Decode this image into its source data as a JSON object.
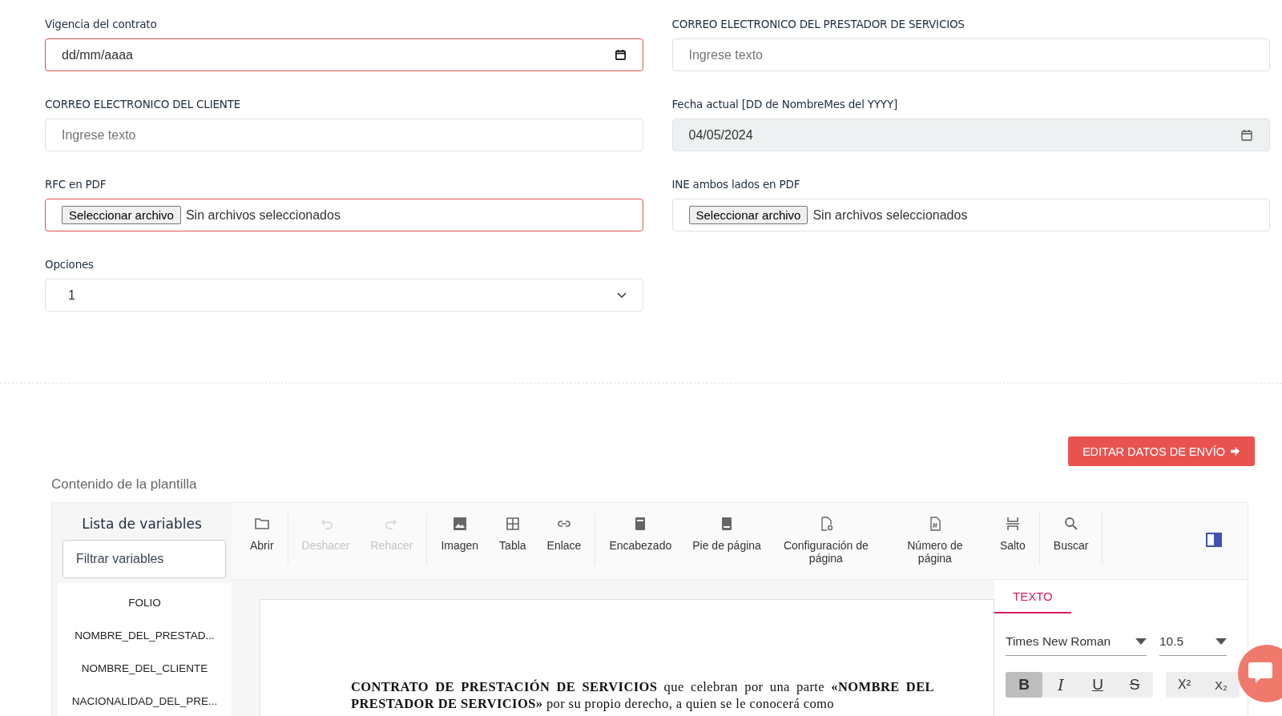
{
  "form_fields": [
    {
      "label": "Vigencia del contrato",
      "kind": "date",
      "value": "dd/mm/aaaa",
      "invalid": true,
      "disabled": false
    },
    {
      "label": "CORREO ELECTRONICO DEL PRESTADOR DE SERVICIOS",
      "kind": "text",
      "placeholder": "Ingrese texto",
      "invalid": false,
      "disabled": false
    },
    {
      "label": "CORREO ELECTRONICO DEL CLIENTE",
      "kind": "text",
      "placeholder": "Ingrese texto",
      "invalid": false,
      "disabled": false
    },
    {
      "label": "Fecha actual [DD de NombreMes del YYYY]",
      "kind": "date",
      "value": "04/05/2024",
      "invalid": false,
      "disabled": true
    },
    {
      "label": "RFC en PDF",
      "kind": "file",
      "button": "Seleccionar archivo",
      "value": "Sin archivos seleccionados",
      "invalid": true,
      "disabled": false
    },
    {
      "label": "INE ambos lados en PDF",
      "kind": "file",
      "button": "Seleccionar archivo",
      "value": "Sin archivos seleccionados",
      "invalid": false,
      "disabled": false
    },
    {
      "label": "Opciones",
      "kind": "select",
      "value": "1",
      "invalid": false,
      "disabled": false
    }
  ],
  "edit_button": "EDITAR DATOS DE ENVÍO",
  "editor": {
    "title": "Contenido de la plantilla",
    "variables": {
      "title": "Lista de variables",
      "filter_placeholder": "Filtrar variables",
      "items": [
        "FOLIO",
        "NOMBRE_DEL_PRESTAD...",
        "NOMBRE_DEL_CLIENTE",
        "NACIONALIDAD_DEL_PRE..."
      ]
    },
    "toolbar": [
      [
        {
          "kind": "folder",
          "label": "Abrir",
          "disabled": false
        }
      ],
      [
        {
          "kind": "undo",
          "label": "Deshacer",
          "disabled": true
        },
        {
          "kind": "redo",
          "label": "Rehacer",
          "disabled": true
        }
      ],
      [
        {
          "kind": "image",
          "label": "Imagen",
          "disabled": false
        },
        {
          "kind": "table",
          "label": "Tabla",
          "disabled": false
        },
        {
          "kind": "link",
          "label": "Enlace",
          "disabled": false
        }
      ],
      [
        {
          "kind": "header",
          "label": "Encabezado",
          "disabled": false
        },
        {
          "kind": "footer",
          "label": "Pie de página",
          "disabled": false
        },
        {
          "kind": "pagesetup",
          "label": "Configuración de página",
          "disabled": false
        },
        {
          "kind": "pagenumber",
          "label": "Número de página",
          "disabled": false
        },
        {
          "kind": "break",
          "label": "Salto",
          "disabled": false
        }
      ],
      [
        {
          "kind": "search",
          "label": "Buscar",
          "disabled": false
        }
      ]
    ],
    "document_text": "**CONTRATO DE PRESTACIÓN DE SERVICIOS** que celebran por una parte **«NOMBRE DEL PRESTADOR DE SERVICIOS»** por su propio derecho, a quien se le conocerá como",
    "panel": {
      "tabs": [
        {
          "label": "TEXTO",
          "selected": true
        }
      ],
      "font": "Times New Roman",
      "size": "10.5",
      "format_buttons": [
        {
          "kind": "bold",
          "label": "B",
          "selected": true
        },
        {
          "kind": "italic",
          "label": "I",
          "selected": false
        },
        {
          "kind": "underline",
          "label": "U",
          "selected": false
        },
        {
          "kind": "strike",
          "label": "S",
          "selected": false
        }
      ],
      "script_buttons": [
        {
          "kind": "sup",
          "label": "X²",
          "selected": false
        },
        {
          "kind": "sub",
          "label": "X₂",
          "selected": false
        }
      ]
    }
  }
}
